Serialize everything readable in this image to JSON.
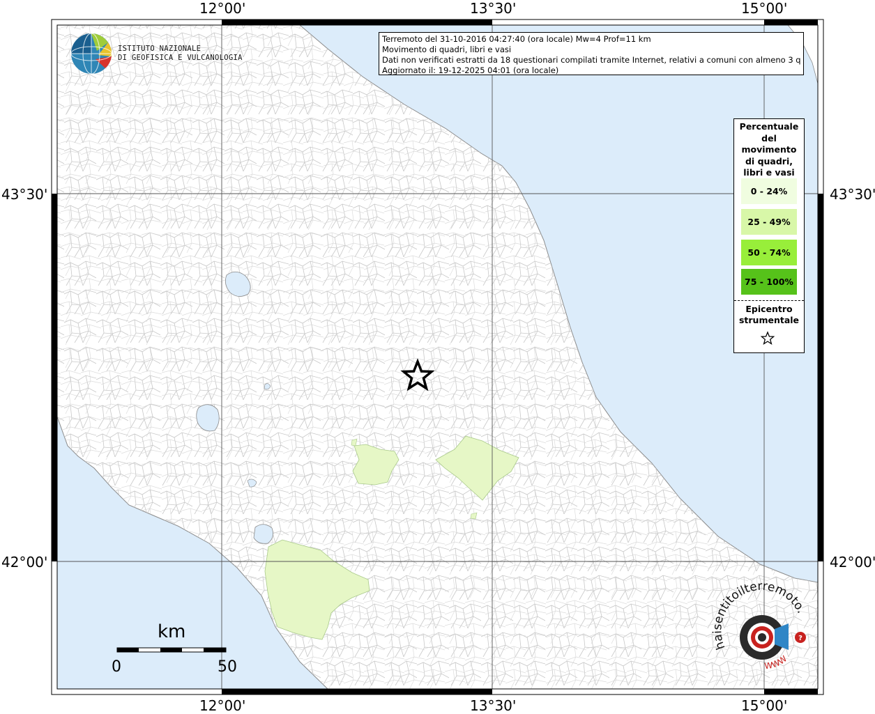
{
  "header": {
    "line1": "Terremoto del 31-10-2016 04:27:40 (ora locale) Mw=4 Prof=11 km",
    "line2": "Movimento di quadri, libri e vasi",
    "line3": "Dati non verificati estratti da 18 questionari compilati tramite Internet, relativi a comuni con almeno 3 questionari.",
    "line4": "Aggiornato il: 19-12-2025 04:01 (ora locale)"
  },
  "institute": {
    "line1": "ISTITUTO NAZIONALE",
    "line2": "DI GEOFISICA E VULCANOLOGIA"
  },
  "axes": {
    "lon": [
      "12°00'",
      "13°30'",
      "15°00'"
    ],
    "lat": [
      "43°30'",
      "42°00'"
    ]
  },
  "legend": {
    "title": [
      "Percentuale",
      "del",
      "movimento",
      "di quadri,",
      "libri e vasi"
    ],
    "classes": [
      {
        "label": "0 - 24%",
        "color": "#f0fde0"
      },
      {
        "label": "25 - 49%",
        "color": "#d8f7a8"
      },
      {
        "label": "50 - 74%",
        "color": "#98ee3a"
      },
      {
        "label": "75 - 100%",
        "color": "#56c21a"
      }
    ],
    "epicenter_title": [
      "Epicentro",
      "strumentale"
    ]
  },
  "scale_bar": {
    "unit": "km",
    "start": "0",
    "end": "50"
  },
  "brand": {
    "main": "haisentitoilterremoto.it",
    "sub": "WWW"
  },
  "colors": {
    "sea": "#dcecfa",
    "land": "#ffffff",
    "border": "#b8b8b8",
    "class_25_49": "#e6f7c6"
  },
  "icons": {
    "epicenter": "star-icon",
    "logo": "ingv-globe-icon",
    "brand": "seismograph-target-icon"
  }
}
